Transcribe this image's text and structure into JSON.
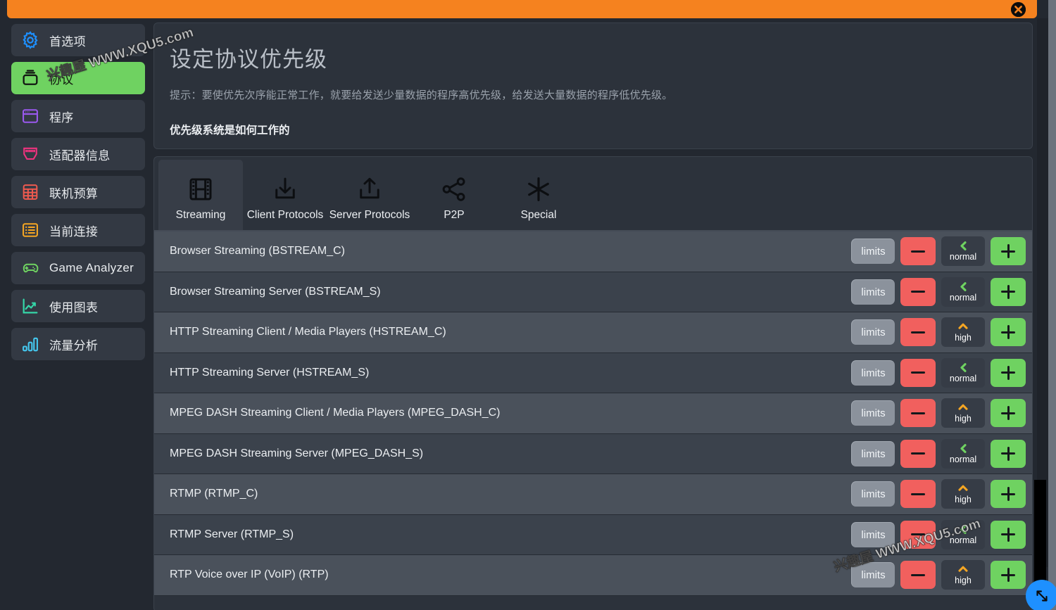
{
  "window": {
    "accent_color": "#f5821f",
    "close_icon": "close-icon"
  },
  "sidebar": {
    "items": [
      {
        "label": "首选项",
        "icon": "gear-icon",
        "color": "#1e90ff",
        "active": false
      },
      {
        "label": "协议",
        "icon": "protocol-icon",
        "color": "#121712",
        "active": true
      },
      {
        "label": "程序",
        "icon": "window-icon",
        "color": "#9b59f0",
        "active": false
      },
      {
        "label": "适配器信息",
        "icon": "ethernet-port-icon",
        "color": "#f0337f",
        "active": false
      },
      {
        "label": "联机预算",
        "icon": "calculator-icon",
        "color": "#f05a4f",
        "active": false
      },
      {
        "label": "当前连接",
        "icon": "list-icon",
        "color": "#f5a623",
        "active": false
      },
      {
        "label": "Game Analyzer",
        "icon": "gamepad-icon",
        "color": "#6fd261",
        "active": false
      },
      {
        "label": "使用图表",
        "icon": "line-chart-icon",
        "color": "#35d6a8",
        "active": false
      },
      {
        "label": "流量分析",
        "icon": "bar-chart-icon",
        "color": "#45c8ef",
        "active": false
      }
    ]
  },
  "header": {
    "title": "设定协议优先级",
    "hint": "提示：要使优先次序能正常工作，就要给发送少量数据的程序高优先级，给发送大量数据的程序低优先级。",
    "link": "优先级系统是如何工作的"
  },
  "tabs": [
    {
      "label": "Streaming",
      "icon": "film-strip-icon",
      "active": true
    },
    {
      "label": "Client Protocols",
      "icon": "download-icon",
      "active": false
    },
    {
      "label": "Server Protocols",
      "icon": "upload-icon",
      "active": false
    },
    {
      "label": "P2P",
      "icon": "share-nodes-icon",
      "active": false
    },
    {
      "label": "Special",
      "icon": "asterisk-icon",
      "active": false
    }
  ],
  "row_controls": {
    "limits_label": "limits",
    "decrease_label": "−",
    "increase_label": "+"
  },
  "priority_colors": {
    "normal": "#6fd261",
    "high": "#f5a623"
  },
  "protocols": [
    {
      "name": "Browser Streaming (BSTREAM_C)",
      "priority": "normal"
    },
    {
      "name": "Browser Streaming Server (BSTREAM_S)",
      "priority": "normal"
    },
    {
      "name": "HTTP Streaming Client / Media Players (HSTREAM_C)",
      "priority": "high"
    },
    {
      "name": "HTTP Streaming Server (HSTREAM_S)",
      "priority": "normal"
    },
    {
      "name": "MPEG DASH Streaming Client / Media Players (MPEG_DASH_C)",
      "priority": "high"
    },
    {
      "name": "MPEG DASH Streaming Server (MPEG_DASH_S)",
      "priority": "normal"
    },
    {
      "name": "RTMP (RTMP_C)",
      "priority": "high"
    },
    {
      "name": "RTMP Server (RTMP_S)",
      "priority": "normal"
    },
    {
      "name": "RTP Voice over IP (VoIP) (RTP)",
      "priority": "high"
    }
  ],
  "watermark": {
    "text": "兴趣屋 WWW.XQU5.com"
  }
}
